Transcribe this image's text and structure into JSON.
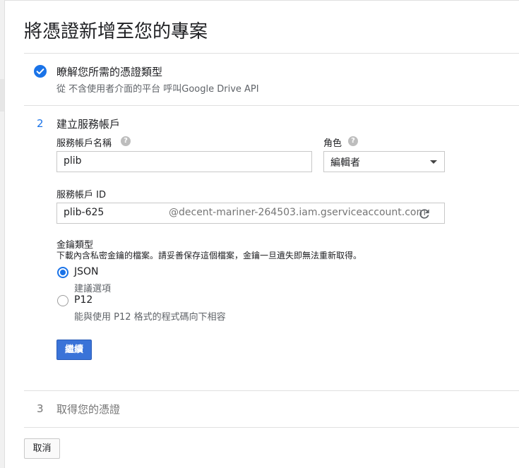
{
  "page_title": "將憑證新增至您的專案",
  "steps": [
    {
      "number": "",
      "title": "瞭解您所需的憑證類型",
      "subtitle": "從 不含使用者介面的平台 呼叫Google Drive API",
      "status": "completed"
    },
    {
      "number": "2",
      "title": "建立服務帳戶",
      "status": "active"
    },
    {
      "number": "3",
      "title": "取得您的憑證",
      "status": "pending"
    }
  ],
  "form": {
    "account_name_label": "服務帳戶名稱",
    "account_name_value": "plib",
    "role_label": "角色",
    "role_value": "編輯者",
    "account_id_label": "服務帳戶 ID",
    "account_id_value": "plib-625",
    "account_id_suffix": "@decent-mariner-264503.iam.gserviceaccount.com",
    "key_type_label": "金鑰類型",
    "key_type_desc": "下載內含私密金鑰的檔案。請妥善保存這個檔案，金鑰一旦遺失即無法重新取得。",
    "key_options": [
      {
        "label": "JSON",
        "desc": "建議選項",
        "selected": true
      },
      {
        "label": "P12",
        "desc": "能與使用 P12 格式的程式碼向下相容",
        "selected": false
      }
    ],
    "continue_label": "繼續"
  },
  "cancel_label": "取消",
  "colors": {
    "accent": "#1a73e8",
    "primary_button": "#3a73d8",
    "pending_text": "#757575"
  },
  "icons": {
    "check": "check-circle-icon",
    "help": "help-circle-icon",
    "dropdown": "caret-down-icon",
    "refresh": "refresh-icon"
  }
}
